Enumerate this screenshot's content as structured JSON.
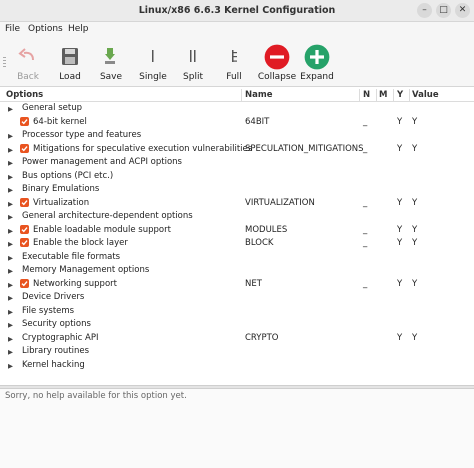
{
  "window": {
    "title": "Linux/x86 6.6.3 Kernel Configuration",
    "minimize": "–",
    "maximize": "□",
    "close": "✕"
  },
  "menu": {
    "file": "File",
    "options": "Options",
    "help": "Help"
  },
  "toolbar": {
    "back": "Back",
    "load": "Load",
    "save": "Save",
    "single": "Single",
    "split": "Split",
    "full": "Full",
    "collapse": "Collapse",
    "expand": "Expand"
  },
  "columns": {
    "options": "Options",
    "name": "Name",
    "n": "N",
    "m": "M",
    "y": "Y",
    "value": "Value"
  },
  "rows": [
    {
      "option": "General setup",
      "name": "",
      "n": "",
      "m": "",
      "y": "",
      "value": ""
    },
    {
      "option": "64-bit kernel",
      "name": "64BIT",
      "n": "_",
      "m": "",
      "y": "Y",
      "value": "Y"
    },
    {
      "option": "Processor type and features",
      "name": "",
      "n": "",
      "m": "",
      "y": "",
      "value": ""
    },
    {
      "option": "Mitigations for speculative execution vulnerabilities",
      "name": "SPECULATION_MITIGATIONS",
      "n": "_",
      "m": "",
      "y": "Y",
      "value": "Y"
    },
    {
      "option": "Power management and ACPI options",
      "name": "",
      "n": "",
      "m": "",
      "y": "",
      "value": ""
    },
    {
      "option": "Bus options (PCI etc.)",
      "name": "",
      "n": "",
      "m": "",
      "y": "",
      "value": ""
    },
    {
      "option": "Binary Emulations",
      "name": "",
      "n": "",
      "m": "",
      "y": "",
      "value": ""
    },
    {
      "option": "Virtualization",
      "name": "VIRTUALIZATION",
      "n": "_",
      "m": "",
      "y": "Y",
      "value": "Y"
    },
    {
      "option": "General architecture-dependent options",
      "name": "",
      "n": "",
      "m": "",
      "y": "",
      "value": ""
    },
    {
      "option": "Enable loadable module support",
      "name": "MODULES",
      "n": "_",
      "m": "",
      "y": "Y",
      "value": "Y"
    },
    {
      "option": "Enable the block layer",
      "name": "BLOCK",
      "n": "_",
      "m": "",
      "y": "Y",
      "value": "Y"
    },
    {
      "option": "Executable file formats",
      "name": "",
      "n": "",
      "m": "",
      "y": "",
      "value": ""
    },
    {
      "option": "Memory Management options",
      "name": "",
      "n": "",
      "m": "",
      "y": "",
      "value": ""
    },
    {
      "option": "Networking support",
      "name": "NET",
      "n": "_",
      "m": "",
      "y": "Y",
      "value": "Y"
    },
    {
      "option": "Device Drivers",
      "name": "",
      "n": "",
      "m": "",
      "y": "",
      "value": ""
    },
    {
      "option": "File systems",
      "name": "",
      "n": "",
      "m": "",
      "y": "",
      "value": ""
    },
    {
      "option": "Security options",
      "name": "",
      "n": "",
      "m": "",
      "y": "",
      "value": ""
    },
    {
      "option": "Cryptographic API",
      "name": "CRYPTO",
      "n": "",
      "m": "",
      "y": "Y",
      "value": "Y"
    },
    {
      "option": "Library routines",
      "name": "",
      "n": "",
      "m": "",
      "y": "",
      "value": ""
    },
    {
      "option": "Kernel hacking",
      "name": "",
      "n": "",
      "m": "",
      "y": "",
      "value": ""
    }
  ],
  "help_text": "Sorry, no help available for this option yet.",
  "colors": {
    "accent": "#e95420",
    "collapse": "#e01b24",
    "expand": "#26a269"
  }
}
